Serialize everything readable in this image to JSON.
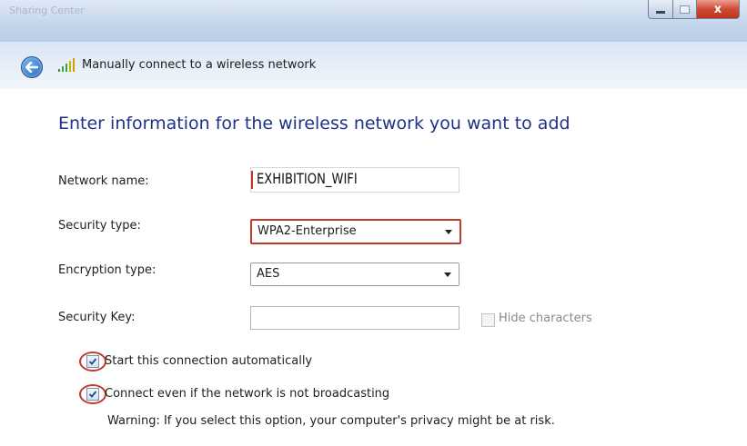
{
  "window": {
    "ghost_title": "Sharing Center",
    "close_glyph": "x"
  },
  "nav": {
    "title": "Manually connect to a wireless network"
  },
  "heading": "Enter information for the wireless network you want to add",
  "form": {
    "network_name_label": "Network name:",
    "network_name_value": "EXHIBITION_WIFI",
    "security_type_label": "Security type:",
    "security_type_value": "WPA2-Enterprise",
    "encryption_type_label": "Encryption type:",
    "encryption_type_value": "AES",
    "security_key_label": "Security Key:",
    "security_key_value": "",
    "hide_characters_label": "Hide characters",
    "hide_characters_checked": false
  },
  "options": {
    "start_auto_label": "Start this connection automatically",
    "start_auto_checked": true,
    "connect_hidden_label": "Connect even if the network is not broadcasting",
    "connect_hidden_checked": true,
    "warning": "Warning: If you select this option, your computer's privacy might be at risk."
  },
  "colors": {
    "heading": "#1e3287",
    "highlight": "#c0392b"
  }
}
